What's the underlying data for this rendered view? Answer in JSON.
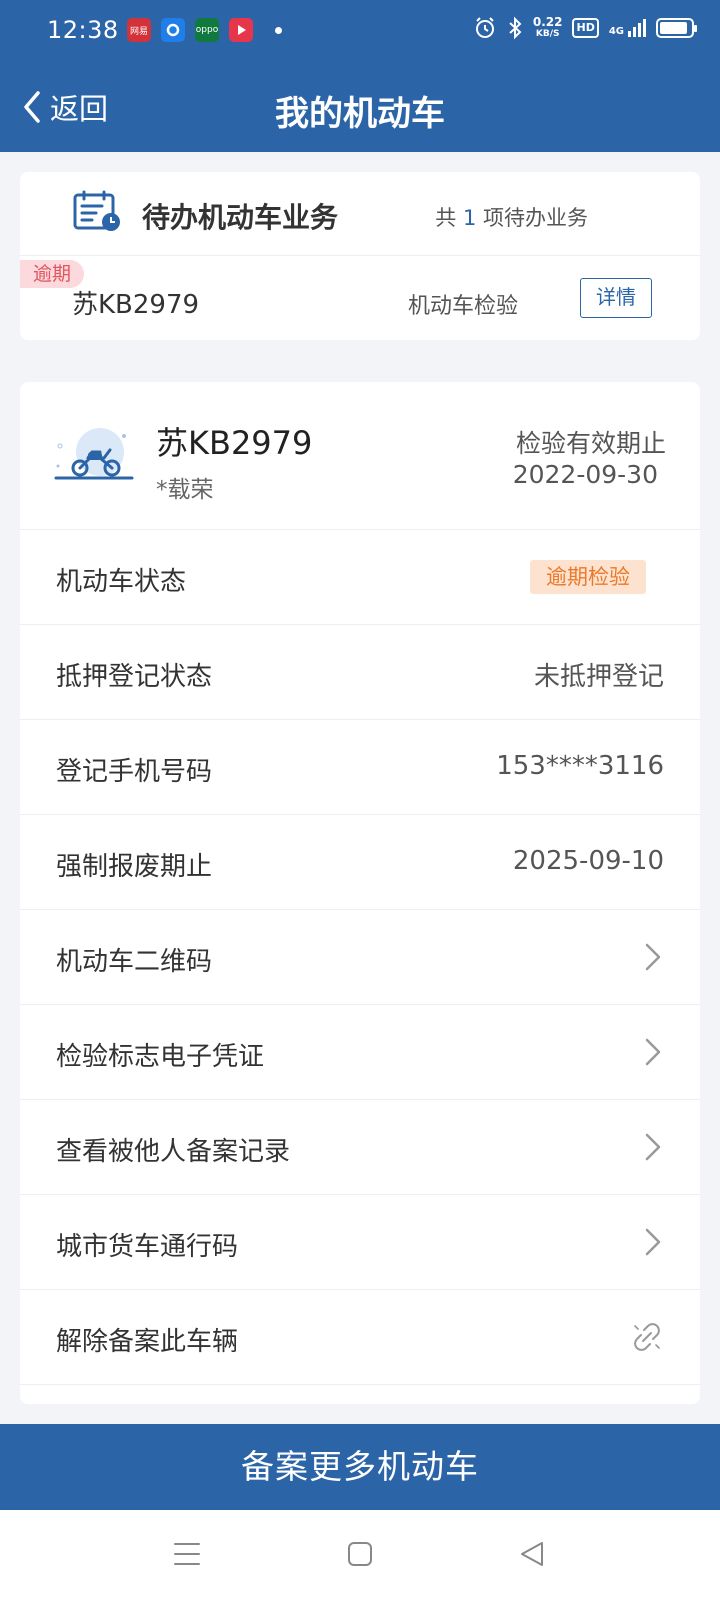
{
  "status_bar": {
    "time": "12:38",
    "app_icons": [
      {
        "name": "netease-cloud-icon",
        "label": "网易",
        "color": "#d2333a"
      },
      {
        "name": "browser-icon",
        "label": "",
        "color": "#1f7ee8"
      },
      {
        "name": "oppo-icon",
        "label": "oppo",
        "color": "#107a3e"
      },
      {
        "name": "video-app-icon",
        "label": "",
        "color": "#e5364b"
      }
    ],
    "speed_value": "0.22",
    "speed_unit": "KB/S",
    "hd": "HD",
    "network": "4G",
    "battery_level": 0.9
  },
  "navbar": {
    "back_label": "返回",
    "title": "我的机动车"
  },
  "pending": {
    "title": "待办机动车业务",
    "count_prefix": "共",
    "count": "1",
    "count_suffix": "项待办业务",
    "item": {
      "tag": "逾期",
      "plate": "苏KB2979",
      "type": "机动车检验",
      "detail_label": "详情"
    }
  },
  "vehicle": {
    "plate": "苏KB2979",
    "owner": "*载荣",
    "expiry_label": "检验有效期止",
    "expiry_date": "2022-09-30",
    "rows": [
      {
        "label": "机动车状态",
        "badge": "逾期检验"
      },
      {
        "label": "抵押登记状态",
        "value": "未抵押登记"
      },
      {
        "label": "登记手机号码",
        "value": "153****3116"
      },
      {
        "label": "强制报废期止",
        "value": "2025-09-10"
      },
      {
        "label": "机动车二维码"
      },
      {
        "label": "检验标志电子凭证"
      },
      {
        "label": "查看被他人备案记录"
      },
      {
        "label": "城市货车通行码"
      },
      {
        "label": "解除备案此车辆"
      }
    ]
  },
  "bottom_button": "备案更多机动车",
  "colors": {
    "brand": "#2c64a8",
    "overdue_red": "#e05560",
    "warning_orange": "#ea7a2b"
  }
}
